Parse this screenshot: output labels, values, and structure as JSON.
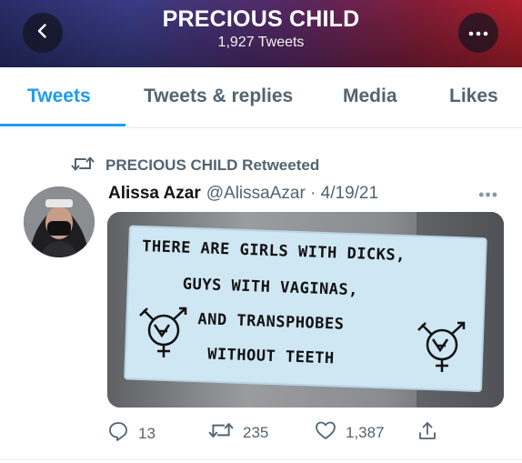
{
  "header": {
    "title": "PRECIOUS CHILD",
    "subtitle": "1,927 Tweets",
    "back_icon": "chevron-left-icon",
    "more_icon": "ellipsis-icon"
  },
  "tabs": [
    {
      "label": "Tweets",
      "active": true
    },
    {
      "label": "Tweets & replies",
      "active": false
    },
    {
      "label": "Media",
      "active": false
    },
    {
      "label": "Likes",
      "active": false
    }
  ],
  "tweet": {
    "retweet_label": "PRECIOUS CHILD Retweeted",
    "author_name": "Alissa Azar",
    "author_meta": "@AlissaAzar · 4/19/21",
    "sticker_lines": [
      "THERE ARE GIRLS WITH DICKS,",
      "GUYS WITH VAGINAS,",
      "AND TRANSPHOBES",
      "WITHOUT TEETH"
    ],
    "reply_count": "13",
    "retweet_count": "235",
    "like_count": "1,387"
  },
  "colors": {
    "accent": "#1d9bf0",
    "secondary_text": "#536471"
  }
}
